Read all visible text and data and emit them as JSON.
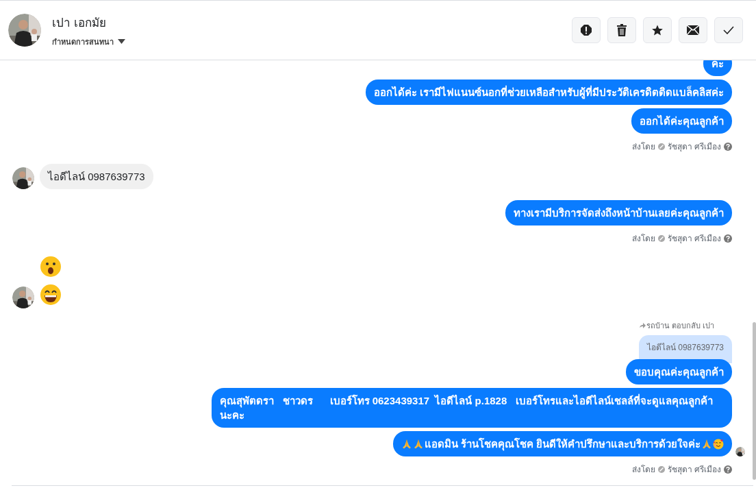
{
  "header": {
    "name": "เปา เอกมัย",
    "subtitle": "กำหนดการสนทนา",
    "actions": [
      {
        "kind": "alert"
      },
      {
        "kind": "trash"
      },
      {
        "kind": "star"
      },
      {
        "kind": "mail"
      },
      {
        "kind": "check"
      }
    ]
  },
  "groups": [
    {
      "kind": "out",
      "items": [
        {
          "kind": "bubble",
          "text": "คะ",
          "seen": false
        },
        {
          "kind": "bubble",
          "text": "ออกได้ค่ะ เรามีไฟแนนซ์นอกที่ช่วยเหลือสำหรับผู้ที่มีประวัติเครดิตติดแบล็คลิสค่ะ",
          "seen": false
        },
        {
          "kind": "bubble",
          "text": "ออกได้ค่ะคุณลูกค้า",
          "seen": false
        },
        {
          "kind": "sent_by",
          "label": "ส่งโดย",
          "name": "รัชสุดา ศรีเมือง"
        }
      ]
    },
    {
      "kind": "in",
      "items": [
        {
          "kind": "bubble",
          "text": "ไอดีไลน์ 0987639773"
        }
      ]
    },
    {
      "kind": "out",
      "items": [
        {
          "kind": "bubble",
          "text": "ทางเรามีบริการจัดส่งถึงหน้าบ้านเลยค่ะคุณลูกค้า",
          "seen": false
        },
        {
          "kind": "sent_by",
          "label": "ส่งโดย",
          "name": "รัชสุดา ศรีเมือง"
        }
      ]
    },
    {
      "kind": "in",
      "items": [
        {
          "kind": "surprised_emoji"
        },
        {
          "kind": "grinning_emoji"
        }
      ]
    },
    {
      "kind": "out",
      "items": [
        {
          "kind": "reply_note",
          "text": "รถบ้าน ตอบกลับ เปา"
        },
        {
          "kind": "quote",
          "text": "ไอดีไลน์ 0987639773"
        },
        {
          "kind": "bubble",
          "text": "ขอบคุณค่ะคุณลูกค้า",
          "seen": false
        },
        {
          "kind": "bubble",
          "text": "คุณสุพัตดรา   ชาวดร      เบอร์โทร 0623439317  ไอดีไลน์ p.1828   เบอร์โทรและไอดีไลน์เชลล์ที่จะดูแลคุณลูกค้านะคะ",
          "seen": false
        },
        {
          "kind": "bubble",
          "lead": [
            {
              "kind": "pray"
            },
            {
              "kind": "pray"
            }
          ],
          "text": "แอดมิน ร้านโชคคุณโชค ยินดีให้คำปรึกษาและบริการด้วยใจค่ะ",
          "trail": [
            {
              "kind": "pray"
            },
            {
              "kind": "smiling-hearts"
            }
          ],
          "seen": true
        },
        {
          "kind": "sent_by",
          "label": "ส่งโดย",
          "name": "รัชสุดา ศรีเมือง"
        }
      ]
    }
  ]
}
